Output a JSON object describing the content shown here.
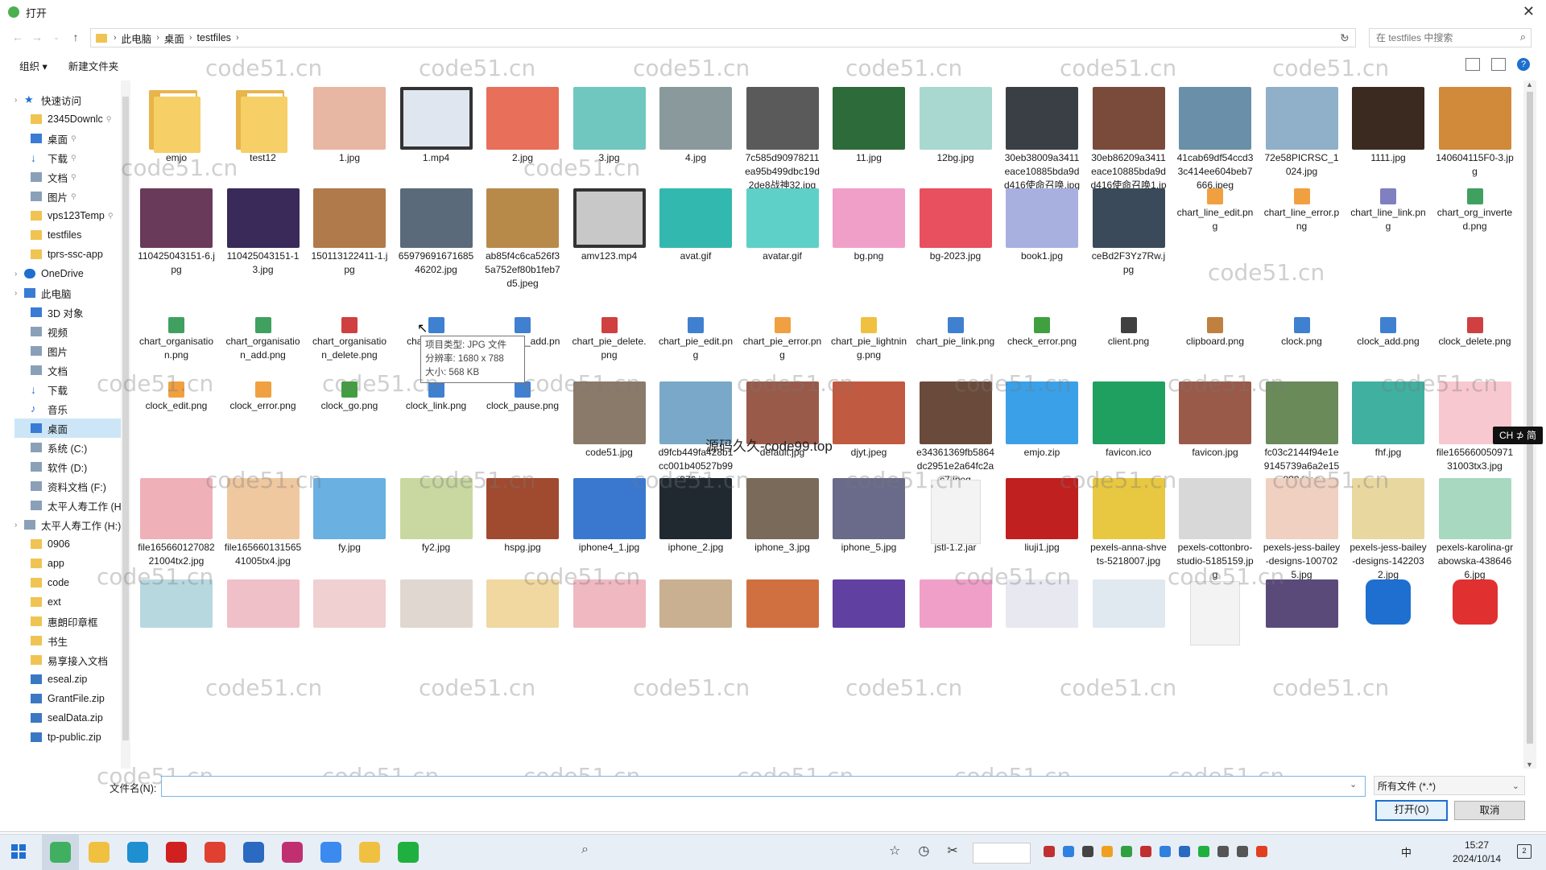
{
  "window": {
    "title": "打开",
    "close_icon": "✕"
  },
  "address": {
    "crumbs": [
      "此电脑",
      "桌面",
      "testfiles"
    ],
    "search_placeholder": "在 testfiles 中搜索"
  },
  "toolbar": {
    "organize": "组织 ▾",
    "new_folder": "新建文件夹",
    "help": "?"
  },
  "sidebar": {
    "items": [
      {
        "label": "快速访问",
        "icon": "star-icon",
        "level": 0,
        "pin": false
      },
      {
        "label": "2345Downlc",
        "icon": "folder-icon",
        "level": 1,
        "pin": true
      },
      {
        "label": "桌面",
        "icon": "desktop-icon",
        "level": 1,
        "pin": true
      },
      {
        "label": "下载",
        "icon": "download-icon",
        "level": 1,
        "pin": true
      },
      {
        "label": "文档",
        "icon": "documents-icon",
        "level": 1,
        "pin": true
      },
      {
        "label": "图片",
        "icon": "pictures-icon",
        "level": 1,
        "pin": true
      },
      {
        "label": "vps123Temp",
        "icon": "folder-icon",
        "level": 1,
        "pin": true
      },
      {
        "label": "testfiles",
        "icon": "folder-icon",
        "level": 1,
        "pin": false
      },
      {
        "label": "tprs-ssc-app",
        "icon": "folder-icon",
        "level": 1,
        "pin": false
      },
      {
        "label": "OneDrive",
        "icon": "cloud-icon",
        "level": 0,
        "pin": false
      },
      {
        "label": "此电脑",
        "icon": "computer-icon",
        "level": 0,
        "pin": false
      },
      {
        "label": "3D 对象",
        "icon": "3d-objects-icon",
        "level": 1,
        "pin": false
      },
      {
        "label": "视频",
        "icon": "videos-icon",
        "level": 1,
        "pin": false
      },
      {
        "label": "图片",
        "icon": "pictures-icon",
        "level": 1,
        "pin": false
      },
      {
        "label": "文档",
        "icon": "documents-icon",
        "level": 1,
        "pin": false
      },
      {
        "label": "下载",
        "icon": "download-icon",
        "level": 1,
        "pin": false
      },
      {
        "label": "音乐",
        "icon": "music-icon",
        "level": 1,
        "pin": false
      },
      {
        "label": "桌面",
        "icon": "desktop-icon",
        "level": 1,
        "pin": false,
        "selected": true
      },
      {
        "label": "系统 (C:)",
        "icon": "drive-icon",
        "level": 1,
        "pin": false
      },
      {
        "label": "软件 (D:)",
        "icon": "drive-icon",
        "level": 1,
        "pin": false
      },
      {
        "label": "资料文档 (F:)",
        "icon": "drive-icon",
        "level": 1,
        "pin": false
      },
      {
        "label": "太平人寿工作 (H",
        "icon": "drive-icon",
        "level": 1,
        "pin": false
      },
      {
        "label": "太平人寿工作 (H:)",
        "icon": "drive-icon",
        "level": 0,
        "pin": false
      },
      {
        "label": "0906",
        "icon": "folder-icon",
        "level": 1,
        "pin": false
      },
      {
        "label": "app",
        "icon": "folder-icon",
        "level": 1,
        "pin": false
      },
      {
        "label": "code",
        "icon": "folder-icon",
        "level": 1,
        "pin": false
      },
      {
        "label": "ext",
        "icon": "folder-icon",
        "level": 1,
        "pin": false
      },
      {
        "label": "惠朗印章框",
        "icon": "folder-icon",
        "level": 1,
        "pin": false
      },
      {
        "label": "书生",
        "icon": "folder-icon",
        "level": 1,
        "pin": false
      },
      {
        "label": "易享接入文档",
        "icon": "folder-icon",
        "level": 1,
        "pin": false
      },
      {
        "label": "eseal.zip",
        "icon": "zip-icon",
        "level": 1,
        "pin": false
      },
      {
        "label": "GrantFile.zip",
        "icon": "zip-icon",
        "level": 1,
        "pin": false
      },
      {
        "label": "sealData.zip",
        "icon": "zip-icon",
        "level": 1,
        "pin": false
      },
      {
        "label": "tp-public.zip",
        "icon": "zip-icon",
        "level": 1,
        "pin": false
      }
    ]
  },
  "files": [
    {
      "name": "emjo",
      "kind": "folder",
      "color": "#f6cf66"
    },
    {
      "name": "test12",
      "kind": "folder",
      "color": "#f6cf66"
    },
    {
      "name": "1.jpg",
      "kind": "image",
      "color": "#e8b7a4"
    },
    {
      "name": "1.mp4",
      "kind": "video",
      "color": "#dfe6f0"
    },
    {
      "name": "2.jpg",
      "kind": "image",
      "color": "#e86f5a"
    },
    {
      "name": "3.jpg",
      "kind": "image",
      "color": "#6fc7c0"
    },
    {
      "name": "4.jpg",
      "kind": "image",
      "color": "#8a9a9c"
    },
    {
      "name": "7c585d90978211ea95b499dbc19d2de8战神32.jpg",
      "kind": "image",
      "color": "#5a5a5a"
    },
    {
      "name": "11.jpg",
      "kind": "image",
      "color": "#2e6b3a"
    },
    {
      "name": "12bg.jpg",
      "kind": "image",
      "color": "#a8d8cf"
    },
    {
      "name": "30eb38009a3411eace10885bda9dd416使命召唤.jpg",
      "kind": "image",
      "color": "#3a3f45"
    },
    {
      "name": "30eb86209a3411eace10885bda9dd416使命召唤1.jpg",
      "kind": "image",
      "color": "#7a4a3a"
    },
    {
      "name": "41cab69df54ccd33c414ee604beb7666.jpeg",
      "kind": "image",
      "color": "#6a8fa8"
    },
    {
      "name": "72e58PICRSC_1024.jpg",
      "kind": "image",
      "color": "#8fb0c8"
    },
    {
      "name": "1111.jpg",
      "kind": "image",
      "color": "#3b2a20"
    },
    {
      "name": "140604115F0-3.jpg",
      "kind": "image",
      "color": "#d08a3a"
    },
    {
      "name": "110425043151-6.jpg",
      "kind": "image",
      "color": "#6a3a5a"
    },
    {
      "name": "110425043151-13.jpg",
      "kind": "image",
      "color": "#3a2a5a"
    },
    {
      "name": "150113122411-1.jpg",
      "kind": "image",
      "color": "#b07a4a"
    },
    {
      "name": "6597969167168546202.jpg",
      "kind": "image",
      "color": "#5a6a7a",
      "selected": true
    },
    {
      "name": "ab85f4c6ca526f35a752ef80b1feb7d5.jpeg",
      "kind": "image",
      "color": "#b88a4a"
    },
    {
      "name": "amv123.mp4",
      "kind": "video",
      "color": "#c8c8c8"
    },
    {
      "name": "avat.gif",
      "kind": "image",
      "color": "#33b8b0"
    },
    {
      "name": "avatar.gif",
      "kind": "image",
      "color": "#5fd0c8"
    },
    {
      "name": "bg.png",
      "kind": "image",
      "color": "#f0a0c8"
    },
    {
      "name": "bg-2023.jpg",
      "kind": "image",
      "color": "#e85060"
    },
    {
      "name": "book1.jpg",
      "kind": "image",
      "color": "#a8b0e0"
    },
    {
      "name": "ceBd2F3Yz7Rw.jpg",
      "kind": "image",
      "color": "#3a4a5a"
    },
    {
      "name": "chart_line_edit.png",
      "kind": "icon",
      "color": "#f0a040"
    },
    {
      "name": "chart_line_error.png",
      "kind": "icon",
      "color": "#f0a040"
    },
    {
      "name": "chart_line_link.png",
      "kind": "icon",
      "color": "#8080c0"
    },
    {
      "name": "chart_org_inverted.png",
      "kind": "icon",
      "color": "#40a060"
    },
    {
      "name": "chart_organisation.png",
      "kind": "icon",
      "color": "#40a060"
    },
    {
      "name": "chart_organisation_add.png",
      "kind": "icon",
      "color": "#40a060"
    },
    {
      "name": "chart_organisation_delete.png",
      "kind": "icon",
      "color": "#d04040"
    },
    {
      "name": "chart_pie.png",
      "kind": "icon",
      "color": "#4080d0"
    },
    {
      "name": "chart_pie_add.png",
      "kind": "icon",
      "color": "#4080d0"
    },
    {
      "name": "chart_pie_delete.png",
      "kind": "icon",
      "color": "#d04040"
    },
    {
      "name": "chart_pie_edit.png",
      "kind": "icon",
      "color": "#4080d0"
    },
    {
      "name": "chart_pie_error.png",
      "kind": "icon",
      "color": "#f0a040"
    },
    {
      "name": "chart_pie_lightning.png",
      "kind": "icon",
      "color": "#f0c040"
    },
    {
      "name": "chart_pie_link.png",
      "kind": "icon",
      "color": "#4080d0"
    },
    {
      "name": "check_error.png",
      "kind": "icon",
      "color": "#40a040"
    },
    {
      "name": "client.png",
      "kind": "icon",
      "color": "#404040"
    },
    {
      "name": "clipboard.png",
      "kind": "icon",
      "color": "#c08040"
    },
    {
      "name": "clock.png",
      "kind": "icon",
      "color": "#4080d0"
    },
    {
      "name": "clock_add.png",
      "kind": "icon",
      "color": "#4080d0"
    },
    {
      "name": "clock_delete.png",
      "kind": "icon",
      "color": "#d04040"
    },
    {
      "name": "clock_edit.png",
      "kind": "icon",
      "color": "#f0a040"
    },
    {
      "name": "clock_error.png",
      "kind": "icon",
      "color": "#f0a040"
    },
    {
      "name": "clock_go.png",
      "kind": "icon",
      "color": "#40a040"
    },
    {
      "name": "clock_link.png",
      "kind": "icon",
      "color": "#4080d0"
    },
    {
      "name": "clock_pause.png",
      "kind": "icon",
      "color": "#4080d0"
    },
    {
      "name": "code51.jpg",
      "kind": "image",
      "color": "#8a7a6a"
    },
    {
      "name": "d9fcb449fa428b1cc001b40527b99076.jpg",
      "kind": "image",
      "color": "#7aa8c8"
    },
    {
      "name": "default.jpg",
      "kind": "image",
      "color": "#9a5a4a"
    },
    {
      "name": "djyt.jpeg",
      "kind": "image",
      "color": "#c05a40"
    },
    {
      "name": "e34361369fb5864dc2951e2a64fc2ac7.jpeg",
      "kind": "image",
      "color": "#6a4a3a"
    },
    {
      "name": "emjo.zip",
      "kind": "zip",
      "color": "#3aa0e8"
    },
    {
      "name": "favicon.ico",
      "kind": "image",
      "color": "#20a060"
    },
    {
      "name": "favicon.jpg",
      "kind": "image",
      "color": "#9a5a4a"
    },
    {
      "name": "fc03c2144f94e1e9145739a6a2e15883.jpeg",
      "kind": "image",
      "color": "#6a8a5a"
    },
    {
      "name": "fhf.jpg",
      "kind": "image",
      "color": "#40b0a0"
    },
    {
      "name": "file16566005097131003tx3.jpg",
      "kind": "image",
      "color": "#f8c8d0"
    },
    {
      "name": "file16566012708221004tx2.jpg",
      "kind": "image",
      "color": "#f0b0b8"
    },
    {
      "name": "file16566013156541005tx4.jpg",
      "kind": "image",
      "color": "#f0c8a0"
    },
    {
      "name": "fy.jpg",
      "kind": "image",
      "color": "#6ab0e0"
    },
    {
      "name": "fy2.jpg",
      "kind": "image",
      "color": "#c8d8a0"
    },
    {
      "name": "hspg.jpg",
      "kind": "image",
      "color": "#a04a30"
    },
    {
      "name": "iphone4_1.jpg",
      "kind": "image",
      "color": "#3a78d0"
    },
    {
      "name": "iphone_2.jpg",
      "kind": "image",
      "color": "#202830"
    },
    {
      "name": "iphone_3.jpg",
      "kind": "image",
      "color": "#7a6a5a"
    },
    {
      "name": "iphone_5.jpg",
      "kind": "image",
      "color": "#6a6a8a"
    },
    {
      "name": "jstl-1.2.jar",
      "kind": "doc",
      "color": "#f3f3f3"
    },
    {
      "name": "liuji1.jpg",
      "kind": "image",
      "color": "#c02020"
    },
    {
      "name": "pexels-anna-shvets-5218007.jpg",
      "kind": "image",
      "color": "#e8c840"
    },
    {
      "name": "pexels-cottonbro-studio-5185159.jpg",
      "kind": "image",
      "color": "#d8d8d8"
    },
    {
      "name": "pexels-jess-bailey-designs-1007025.jpg",
      "kind": "image",
      "color": "#f0d0c0"
    },
    {
      "name": "pexels-jess-bailey-designs-1422032.jpg",
      "kind": "image",
      "color": "#e8d8a0"
    },
    {
      "name": "pexels-karolina-grabowska-4386466.jpg",
      "kind": "image",
      "color": "#a8d8c0"
    },
    {
      "name": "",
      "kind": "image",
      "color": "#b8d8e0"
    },
    {
      "name": "",
      "kind": "image",
      "color": "#f0c0c8"
    },
    {
      "name": "",
      "kind": "image",
      "color": "#f0d0d0"
    },
    {
      "name": "",
      "kind": "image",
      "color": "#e0d8d0"
    },
    {
      "name": "",
      "kind": "image",
      "color": "#f0d8a0"
    },
    {
      "name": "",
      "kind": "image",
      "color": "#f0b8c0"
    },
    {
      "name": "",
      "kind": "image",
      "color": "#c8b090"
    },
    {
      "name": "",
      "kind": "image",
      "color": "#d07040"
    },
    {
      "name": "",
      "kind": "image",
      "color": "#6040a0"
    },
    {
      "name": "",
      "kind": "image",
      "color": "#f0a0c8"
    },
    {
      "name": "",
      "kind": "image",
      "color": "#e8e8f0"
    },
    {
      "name": "",
      "kind": "image",
      "color": "#e0e8f0"
    },
    {
      "name": "",
      "kind": "doc",
      "color": "#f3f3f3"
    },
    {
      "name": "",
      "kind": "image",
      "color": "#5a4a7a"
    },
    {
      "name": "",
      "kind": "app",
      "color": "#1e6fd0"
    },
    {
      "name": "",
      "kind": "app",
      "color": "#e03030"
    }
  ],
  "tooltip": {
    "type": "项目类型: JPG 文件",
    "resolution": "分辨率: 1680 x 788",
    "size": "大小: 568 KB"
  },
  "watermark": {
    "text": "code51.cn",
    "center": "源码久久-code99.top"
  },
  "ime": {
    "label": "CH ⊅ 简"
  },
  "bottom": {
    "filename_label": "文件名(N):",
    "filename_value": "",
    "filter": "所有文件 (*.*)",
    "open_button": "打开(O)",
    "cancel_button": "取消"
  },
  "taskbar": {
    "apps": [
      {
        "name": "360-browser-icon",
        "color": "#40b060"
      },
      {
        "name": "file-explorer-icon",
        "color": "#f0c040"
      },
      {
        "name": "edge-icon",
        "color": "#1e8fd0"
      },
      {
        "name": "wps-icon",
        "color": "#d02020"
      },
      {
        "name": "chrome-icon",
        "color": "#e04030"
      },
      {
        "name": "vs-code-icon",
        "color": "#2a6ac0"
      },
      {
        "name": "intellij-icon",
        "color": "#c03070"
      },
      {
        "name": "feishu-icon",
        "color": "#3a8af0"
      },
      {
        "name": "qq-icon",
        "color": "#f0c040"
      },
      {
        "name": "wechat-icon",
        "color": "#20b040"
      }
    ],
    "lang": "中",
    "time": "15:27",
    "date": "2024/10/14",
    "notif": "2"
  }
}
